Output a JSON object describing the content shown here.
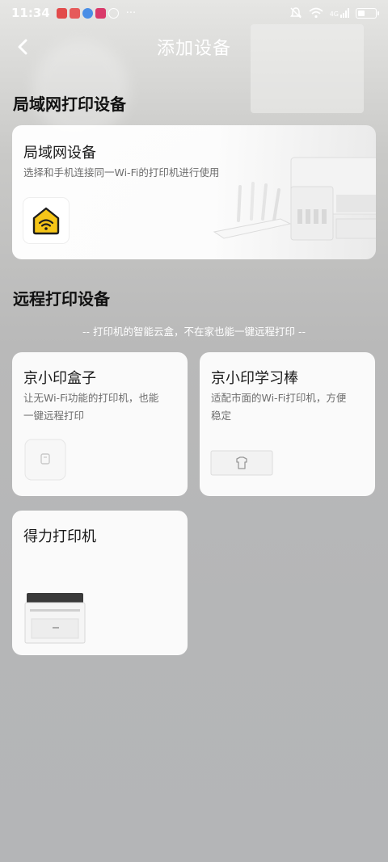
{
  "status_bar": {
    "time": "11:34",
    "more": "···",
    "network": "4G"
  },
  "nav": {
    "title": "添加设备"
  },
  "lan_section": {
    "title": "局域网打印设备",
    "card": {
      "title": "局域网设备",
      "desc": "选择和手机连接同一Wi-Fi的打印机进行使用"
    }
  },
  "remote_section": {
    "title": "远程打印设备",
    "subtitle": "-- 打印机的智能云盒，不在家也能一键远程打印 --",
    "cards": [
      {
        "title": "京小印盒子",
        "desc_line1": "让无Wi-Fi功能的打印机，也能",
        "desc_line2": "一键远程打印"
      },
      {
        "title": "京小印学习棒",
        "desc_line1": "适配市面的Wi-Fi打印机，方便",
        "desc_line2": "稳定"
      },
      {
        "title": "得力打印机"
      }
    ]
  },
  "colors": {
    "accent_wifi": "#f5c518",
    "text_dark": "#1a1a1a",
    "text_muted": "#6d6d6d"
  }
}
